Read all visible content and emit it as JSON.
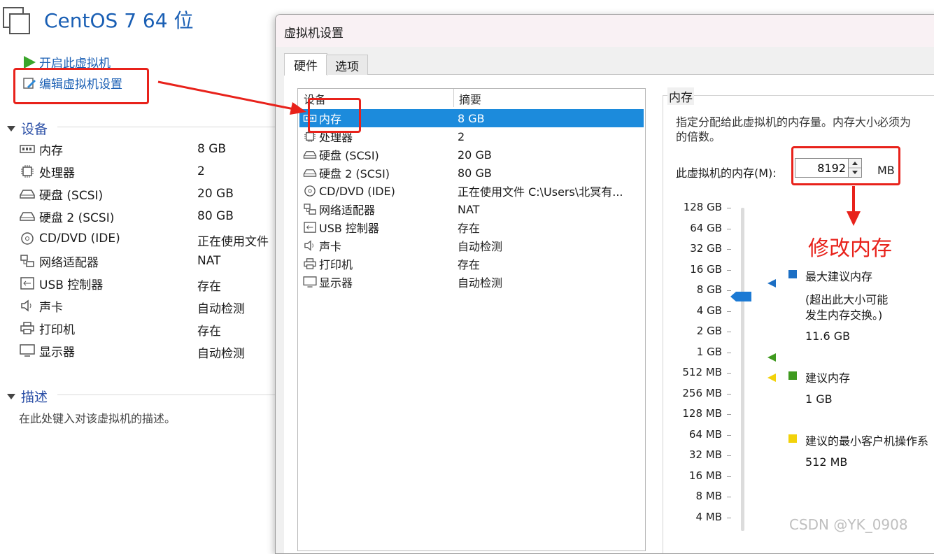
{
  "vm": {
    "title": "CentOS 7 64 位"
  },
  "actions": {
    "power_on": "开启此虚拟机",
    "edit_settings": "编辑虚拟机设置"
  },
  "devices_section": {
    "title": "设备",
    "items": [
      {
        "name": "内存",
        "value": "8 GB",
        "icon": "memory-icon"
      },
      {
        "name": "处理器",
        "value": "2",
        "icon": "cpu-icon"
      },
      {
        "name": "硬盘 (SCSI)",
        "value": "20 GB",
        "icon": "hard-disk-icon"
      },
      {
        "name": "硬盘 2 (SCSI)",
        "value": "80 GB",
        "icon": "hard-disk-icon"
      },
      {
        "name": "CD/DVD (IDE)",
        "value": "正在使用文件",
        "icon": "cd-dvd-icon"
      },
      {
        "name": "网络适配器",
        "value": "NAT",
        "icon": "network-icon"
      },
      {
        "name": "USB 控制器",
        "value": "存在",
        "icon": "usb-icon"
      },
      {
        "name": "声卡",
        "value": "自动检测",
        "icon": "sound-icon"
      },
      {
        "name": "打印机",
        "value": "存在",
        "icon": "printer-icon"
      },
      {
        "name": "显示器",
        "value": "自动检测",
        "icon": "display-icon"
      }
    ]
  },
  "description_section": {
    "title": "描述",
    "placeholder": "在此处键入对该虚拟机的描述。"
  },
  "dialog": {
    "title": "虚拟机设置",
    "tabs": [
      "硬件",
      "选项"
    ],
    "hardware_list": {
      "headers": [
        "设备",
        "摘要"
      ],
      "rows": [
        {
          "device": "内存",
          "summary": "8 GB"
        },
        {
          "device": "处理器",
          "summary": "2"
        },
        {
          "device": "硬盘 (SCSI)",
          "summary": "20 GB"
        },
        {
          "device": "硬盘 2 (SCSI)",
          "summary": "80 GB"
        },
        {
          "device": "CD/DVD (IDE)",
          "summary": "正在使用文件 C:\\Users\\北冥有..."
        },
        {
          "device": "网络适配器",
          "summary": "NAT"
        },
        {
          "device": "USB 控制器",
          "summary": "存在"
        },
        {
          "device": "声卡",
          "summary": "自动检测"
        },
        {
          "device": "打印机",
          "summary": "存在"
        },
        {
          "device": "显示器",
          "summary": "自动检测"
        }
      ]
    },
    "memory": {
      "group_label": "内存",
      "desc_line1": "指定分配给此虚拟机的内存量。内存大小必须为",
      "desc_line2": "的倍数。",
      "input_label": "此虚拟机的内存(M):",
      "input_value": "8192",
      "unit": "MB",
      "scale": [
        "128 GB",
        "64 GB",
        "32 GB",
        "16 GB",
        "8 GB",
        "4 GB",
        "2 GB",
        "1 GB",
        "512 MB",
        "256 MB",
        "128 MB",
        "64 MB",
        "32 MB",
        "16 MB",
        "8 MB",
        "4 MB"
      ],
      "max_recommended": {
        "label": "最大建议内存",
        "note1": "(超出此大小可能",
        "note2": "发生内存交换。)",
        "value": "11.6 GB",
        "color": "#1c6fc4"
      },
      "recommended": {
        "label": "建议内存",
        "value": "1 GB",
        "color": "#3f9a1f"
      },
      "min_recommended": {
        "label": "建议的最小客户机操作系",
        "value": "512 MB",
        "color": "#f2d20a"
      }
    }
  },
  "annotation": {
    "text": "修改内存",
    "color": "#e8221b"
  },
  "watermark": "CSDN @YK_0908"
}
